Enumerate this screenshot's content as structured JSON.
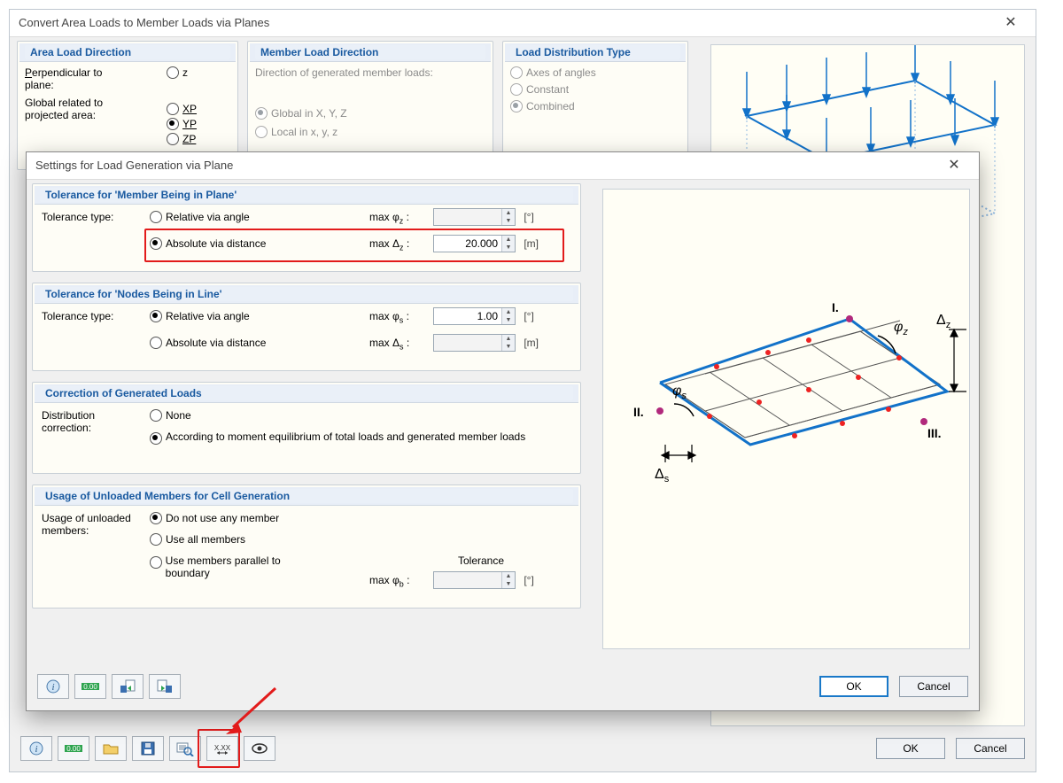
{
  "outer": {
    "title": "Convert Area Loads to Member Loads via Planes",
    "ok": "OK",
    "cancel": "Cancel",
    "groups": {
      "area_dir": {
        "title": "Area Load Direction",
        "perp_label": "Perpendicular to plane:",
        "global_label": "Global related to projected area:",
        "z": "z",
        "xp": "XP",
        "yp": "YP",
        "zp": "ZP"
      },
      "member_dir": {
        "title": "Member Load Direction",
        "hint": "Direction of generated member loads:",
        "global": "Global in X, Y, Z",
        "local": "Local in x, y, z"
      },
      "dist_type": {
        "title": "Load Distribution Type",
        "axes": "Axes of angles",
        "constant": "Constant",
        "combined": "Combined"
      }
    },
    "toolbar_icons": [
      "help-icon",
      "zero-dec-icon",
      "open-icon",
      "save-icon",
      "inspect-icon",
      "precision-icon",
      "eye-icon"
    ]
  },
  "inner": {
    "title": "Settings for Load Generation via Plane",
    "ok": "OK",
    "cancel": "Cancel",
    "sec1": {
      "title": "Tolerance for 'Member Being in Plane'",
      "label": "Tolerance type:",
      "opt_rel": "Relative via angle",
      "opt_abs": "Absolute via distance",
      "max_phi": "max φ",
      "max_delta": "max Δ",
      "sub_z": "z",
      "deg": "[°]",
      "m": "[m]",
      "value": "20.000"
    },
    "sec2": {
      "title": "Tolerance for 'Nodes Being in Line'",
      "label": "Tolerance type:",
      "opt_rel": "Relative via angle",
      "opt_abs": "Absolute via distance",
      "max_phi": "max φ",
      "max_delta": "max Δ",
      "sub_s": "s",
      "deg": "[°]",
      "m": "[m]",
      "value": "1.00"
    },
    "sec3": {
      "title": "Correction of Generated Loads",
      "label": "Distribution correction:",
      "opt_none": "None",
      "opt_equil": "According to moment equilibrium of total loads and generated member loads"
    },
    "sec4": {
      "title": "Usage of Unloaded Members for Cell Generation",
      "label": "Usage of unloaded members:",
      "opt1": "Do not use any member",
      "opt2": "Use all members",
      "opt3": "Use members parallel to boundary",
      "max_phi": "max φ",
      "sub_b": "b",
      "deg": "[°]",
      "tolerance": "Tolerance"
    },
    "diagram_labels": {
      "I": "I.",
      "II": "II.",
      "III": "III.",
      "phiz": "φz",
      "phis": "φs",
      "dz": "Δz",
      "ds": "Δs"
    },
    "toolbar_icons": [
      "help-icon",
      "zero-dec-icon",
      "copy-in-icon",
      "copy-out-icon"
    ]
  }
}
